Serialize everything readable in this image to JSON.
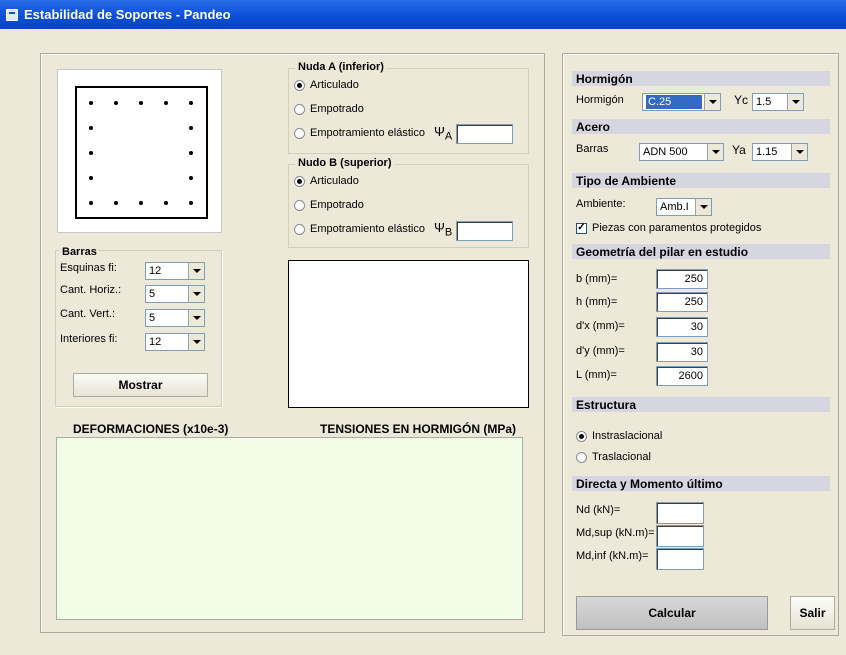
{
  "window": {
    "title": "Estabilidad de Soportes - Pandeo"
  },
  "barras": {
    "title": "Barras",
    "esquinas": {
      "label": "Esquinas fi:",
      "value": "12"
    },
    "horiz": {
      "label": "Cant. Horiz.:",
      "value": "5"
    },
    "vert": {
      "label": "Cant. Vert.:",
      "value": "5"
    },
    "interiores": {
      "label": "Interiores fi:",
      "value": "12"
    },
    "mostrar_label": "Mostrar"
  },
  "nudo_a": {
    "title": "Nuda A (inferior)",
    "articulado": "Articulado",
    "empotrado": "Empotrado",
    "elastico": "Empotramiento elástico",
    "psi": "Ψ",
    "sub": "A",
    "value": ""
  },
  "nudo_b": {
    "title": "Nudo B (superior)",
    "articulado": "Articulado",
    "empotrado": "Empotrado",
    "elastico": "Empotramiento elástico",
    "psi": "Ψ",
    "sub": "B",
    "value": ""
  },
  "bottom": {
    "deformaciones": "DEFORMACIONES (x10e-3)",
    "tensiones": "TENSIONES EN HORMIGÓN (MPa)"
  },
  "hormigon": {
    "header": "Hormigón",
    "label": "Hormigón",
    "value": "C.25",
    "gamma_label": "Yc",
    "gamma_value": "1.5"
  },
  "acero": {
    "header": "Acero",
    "label": "Barras",
    "value": "ADN 500",
    "gamma_label": "Ya",
    "gamma_value": "1.15"
  },
  "ambiente": {
    "header": "Tipo de Ambiente",
    "label": "Ambiente:",
    "value": "Amb.I",
    "check_label": "Piezas con paramentos protegidos"
  },
  "geometria": {
    "header": "Geometría del pilar en estudio",
    "b": {
      "label": "b (mm)=",
      "value": "250"
    },
    "h": {
      "label": "h (mm)=",
      "value": "250"
    },
    "dx": {
      "label": "d'x (mm)=",
      "value": "30"
    },
    "dy": {
      "label": "d'y (mm)=",
      "value": "30"
    },
    "L": {
      "label": "L (mm)=",
      "value": "2600"
    }
  },
  "estructura": {
    "header": "Estructura",
    "intra": "Instraslacional",
    "tras": "Traslacional"
  },
  "directa": {
    "header": "Directa y Momento último",
    "nd": {
      "label": "Nd (kN)=",
      "value": ""
    },
    "mdsup": {
      "label": "Md,sup (kN.m)=",
      "value": ""
    },
    "mdinf": {
      "label": "Md,inf (kN.m)=",
      "value": ""
    }
  },
  "buttons": {
    "calcular": "Calcular",
    "salir": "Salir"
  }
}
